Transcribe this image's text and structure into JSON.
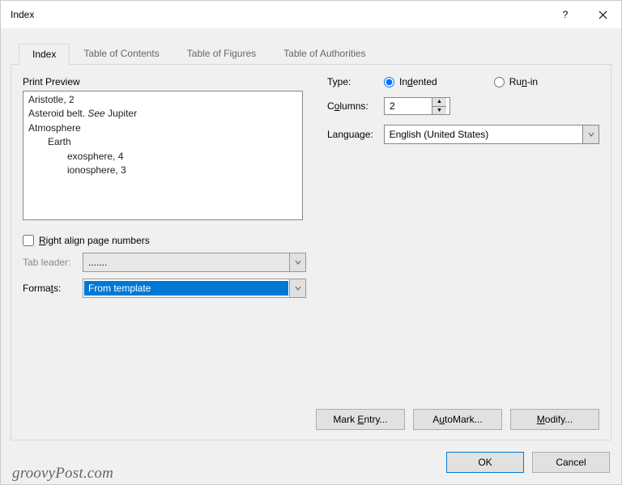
{
  "window": {
    "title": "Index"
  },
  "tabs": {
    "index": "Index",
    "toc": "Table of Contents",
    "tof": "Table of Figures",
    "toa": "Table of Authorities"
  },
  "preview": {
    "label": "Print Preview",
    "lines": {
      "l0": "Aristotle, 2",
      "l1a": "Asteroid belt. ",
      "l1b": "See",
      "l1c": " Jupiter",
      "l2": "Atmosphere",
      "l3": "Earth",
      "l4": "exosphere, 4",
      "l5": "ionosphere, 3"
    }
  },
  "options": {
    "right_align_label": "Right align page numbers",
    "tab_leader_label": "Tab leader:",
    "tab_leader_value": ".......",
    "formats_label": "Formats:",
    "formats_value": "From template"
  },
  "right": {
    "type_label": "Type:",
    "indented_label": "Indented",
    "runin_label": "Run-in",
    "columns_label": "Columns:",
    "columns_value": "2",
    "language_label": "Language:",
    "language_value": "English (United States)"
  },
  "buttons": {
    "mark_entry": "Mark Entry...",
    "automark": "AutoMark...",
    "modify": "Modify...",
    "ok": "OK",
    "cancel": "Cancel"
  },
  "watermark": "groovyPost.com"
}
